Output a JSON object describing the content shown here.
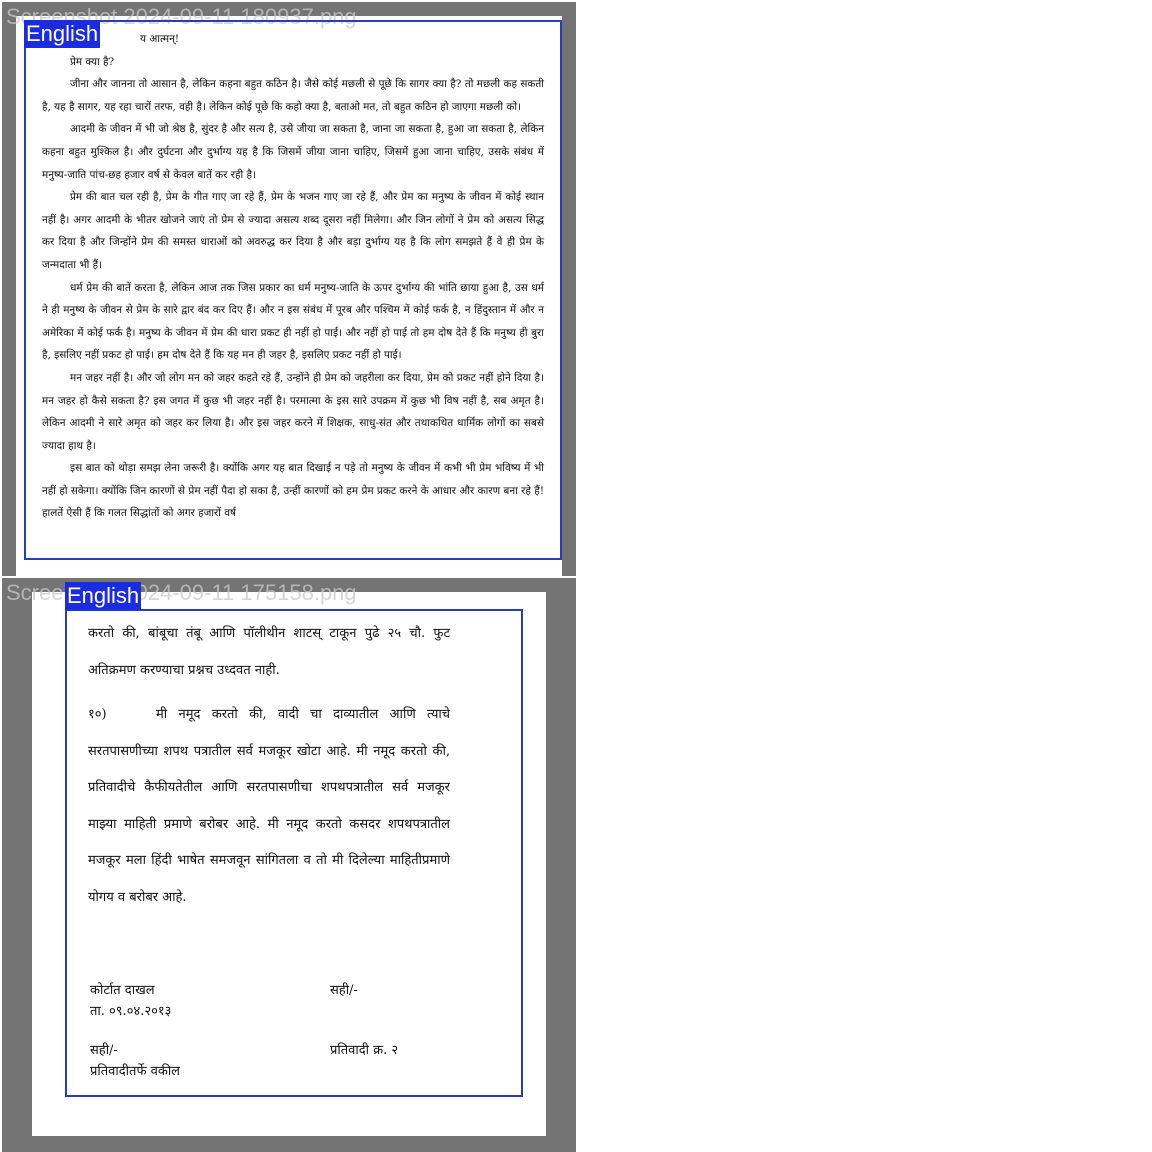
{
  "screenshots": [
    {
      "filename": "Screenshot 2024-09-11 180937.png",
      "language_tag": "English",
      "intro_lines": [
        "य आत्मन्!",
        "प्रेम क्या है?"
      ],
      "paragraphs": [
        "जीना और जानना तो आसान है, लेकिन कहना बहुत कठिन है। जैसे कोई मछली से पूछे कि सागर क्या है? तो मछली कह सकती है, यह है सागर, यह रहा चारों तरफ, वही है। लेकिन कोई पूछे कि कहो क्या है, बताओ मत, तो बहुत कठिन हो जाएगा मछली को।",
        "आदमी के जीवन में भी जो श्रेष्ठ है, सुंदर है और सत्य है, उसे जीया जा सकता है, जाना जा सकता है, हुआ जा सकता है, लेकिन कहना बहुत मुश्किल है। और दुर्घटना और दुर्भाग्य यह है कि जिसमें जीया जाना चाहिए, जिसमें हुआ जाना चाहिए, उसके संबंध में मनुष्य-जाति पांच-छह हजार वर्ष से केवल बातें कर रही है।",
        "प्रेम की बात चल रही है, प्रेम के गीत गाए जा रहे हैं, प्रेम के भजन गाए जा रहे हैं, और प्रेम का मनुष्य के जीवन में कोई स्थान नहीं है। अगर आदमी के भीतर खोजने जाएं तो प्रेम से ज्यादा असत्य शब्द दूसरा नहीं मिलेगा। और जिन लोगों ने प्रेम को असत्य सिद्ध कर दिया है और जिन्होंने प्रेम की समस्त धाराओं को अवरुद्ध कर दिया है और बड़ा दुर्भाग्य यह है कि लोग समझते हैं वे ही प्रेम के जन्मदाता भी हैं।",
        "धर्म प्रेम की बातें करता है, लेकिन आज तक जिस प्रकार का धर्म मनुष्य-जाति के ऊपर दुर्भाग्य की भांति छाया हुआ है, उस धर्म ने ही मनुष्य के जीवन से प्रेम के सारे द्वार बंद कर दिए हैं। और न इस संबंध में पूरब और पश्चिम में कोई फर्क है, न हिंदुस्तान में और न अमेरिका में कोई फर्क है। मनुष्य के जीवन में प्रेम की धारा प्रकट ही नहीं हो पाई। और नहीं हो पाई तो हम दोष देते हैं कि मनुष्य ही बुरा है, इसलिए नहीं प्रकट हो पाई। हम दोष देते हैं कि यह मन ही जहर है, इसलिए प्रकट नहीं हो पाई।",
        "मन जहर नहीं है। और जो लोग मन को जहर कहते रहे हैं, उन्होंने ही प्रेम को जहरीला कर दिया, प्रेम को प्रकट नहीं होने दिया है। मन जहर हो कैसे सकता है? इस जगत में कुछ भी जहर नहीं है। परमात्मा के इस सारे उपक्रम में कुछ भी विष नहीं है, सब अमृत है। लेकिन आदमी ने सारे अमृत को जहर कर लिया है। और इस जहर करने में शिक्षक, साधु-संत और तथाकथित धार्मिक लोगों का सबसे ज्यादा हाथ है।",
        "इस बात को थोड़ा समझ लेना जरूरी है। क्योंकि अगर यह बात दिखाई न पड़े तो मनुष्य के जीवन में कभी भी प्रेम भविष्य में भी नहीं हो सकेगा। क्योंकि जिन कारणों से प्रेम नहीं पैदा हो सका है, उन्हीं कारणों को हम प्रेम प्रकट करने के आधार और कारण बना रहे हैं! हालतें ऐसी हैं कि गलत सिद्धांतों को अगर हजारों वर्ष"
      ]
    },
    {
      "filename": "Screenshot 2024-09-11 175158.png",
      "language_tag": "English",
      "para_top": "करतो की, बांबूचा तंबू आणि पॉलीथीन शाटस् टाकून पुढे २५ चौ. फुट अतिक्रमण करण्याचा प्रश्नच उध्दवत नाही.",
      "para_num": "१०)",
      "para_main": "मी नमूद करतो की, वादी चा दाव्यातील आणि त्याचे सरतपासणीच्या शपथ पत्रातील सर्व मजकूर खोटा आहे. मी नमूद करतो की, प्रतिवादीचे कैफीयतेतील आणि सरतपासणीचा शपथपत्रातील सर्व मजकूर माझ्या माहिती प्रमाणे बरोबर आहे. मी नमूद करतो कसदर शपथपत्रातील मजकूर मला हिंदी भाषेत समजवून सांगितला व तो मी दिलेल्या माहितीप्रमाणे योगय व बरोबर आहे.",
      "left_sig_1": "कोर्टात दाखल",
      "left_sig_2": "ता. ०९.०४.२०१३",
      "right_sig_1": "सही/-",
      "left_sig_3": "सही/-",
      "left_sig_4": "प्रतिवादीतर्फे वकील",
      "right_sig_2": "प्रतिवादी क्र. २"
    }
  ]
}
